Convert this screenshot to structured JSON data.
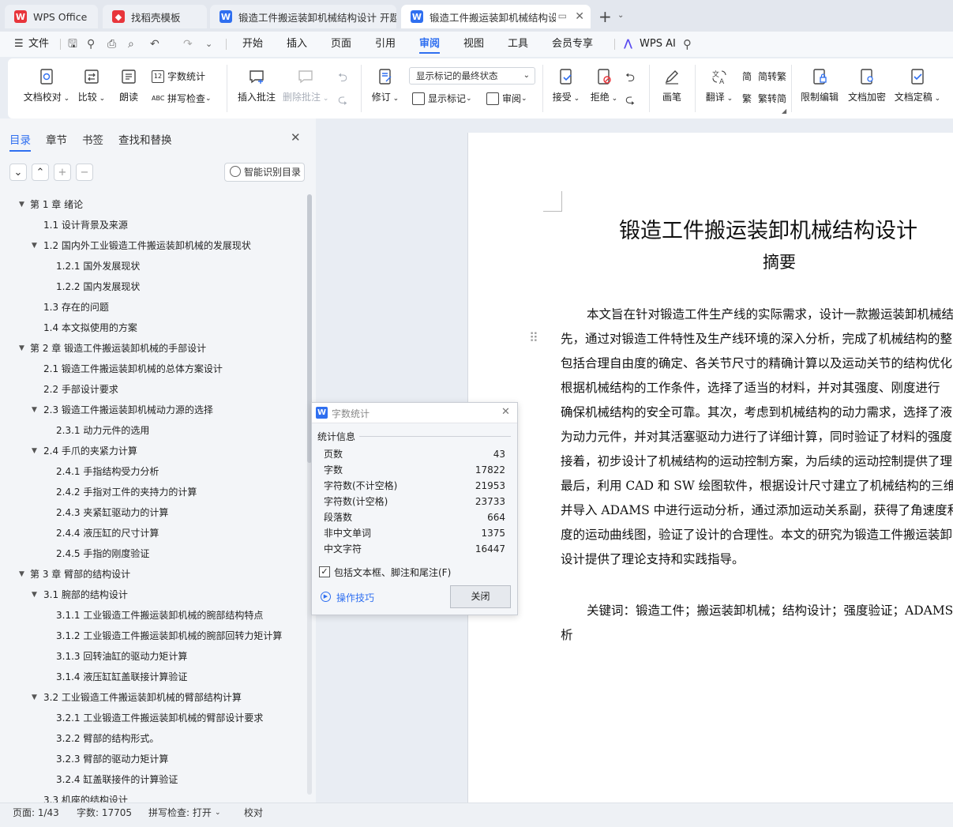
{
  "tabs": [
    {
      "label": "WPS Office",
      "logo": "W",
      "color": "#e8353b"
    },
    {
      "label": "找稻壳模板",
      "logo": "稻",
      "color": "#e8353b"
    },
    {
      "label": "锻造工件搬运装卸机械结构设计 开题",
      "logo": "W",
      "color": "#2f6ff0"
    },
    {
      "label": "锻造工件搬运装卸机械结构设",
      "logo": "W",
      "color": "#2f6ff0"
    }
  ],
  "menu": {
    "file": "文件",
    "items": [
      "开始",
      "插入",
      "页面",
      "引用",
      "审阅",
      "视图",
      "工具",
      "会员专享"
    ],
    "active": "审阅",
    "ai": "WPS AI"
  },
  "ribbon": {
    "doc_check": "文档校对",
    "compare": "比较",
    "read_aloud": "朗读",
    "word_count": "字数统计",
    "spell_check": "拼写检查",
    "insert_comment": "插入批注",
    "delete_comment": "删除批注",
    "track": "修订",
    "markup_state": "显示标记的最终状态",
    "show_markup": "显示标记",
    "review": "审阅",
    "accept": "接受",
    "reject": "拒绝",
    "pen": "画笔",
    "translate": "翻译",
    "to_traditional": "简转繁",
    "to_simplified": "繁转简",
    "restrict": "限制编辑",
    "encrypt": "文档加密",
    "finalize": "文档定稿"
  },
  "panel": {
    "tabs": [
      "目录",
      "章节",
      "书签",
      "查找和替换"
    ],
    "smart_toc": "智能识别目录",
    "toc": [
      {
        "text": "第 1 章  绪论",
        "level": 0,
        "expand": true
      },
      {
        "text": "1.1 设计背景及来源",
        "level": 1,
        "expand": false
      },
      {
        "text": "1.2 国内外工业锻造工件搬运装卸机械的发展现状",
        "level": 1,
        "expand": true
      },
      {
        "text": "1.2.1 国外发展现状",
        "level": 2,
        "expand": false
      },
      {
        "text": "1.2.2 国内发展现状",
        "level": 2,
        "expand": false
      },
      {
        "text": "1.3 存在的问题",
        "level": 1,
        "expand": false
      },
      {
        "text": "1.4 本文拟使用的方案",
        "level": 1,
        "expand": false
      },
      {
        "text": "第 2 章  锻造工件搬运装卸机械的手部设计",
        "level": 0,
        "expand": true
      },
      {
        "text": "2.1  锻造工件搬运装卸机械的总体方案设计",
        "level": 1,
        "expand": false
      },
      {
        "text": "2.2  手部设计要求",
        "level": 1,
        "expand": false
      },
      {
        "text": "2.3  锻造工件搬运装卸机械动力源的选择",
        "level": 1,
        "expand": true
      },
      {
        "text": "2.3.1 动力元件的选用",
        "level": 2,
        "expand": false
      },
      {
        "text": "2.4  手爪的夹紧力计算",
        "level": 1,
        "expand": true
      },
      {
        "text": "2.4.1  手指结构受力分析",
        "level": 2,
        "expand": false
      },
      {
        "text": "2.4.2 手指对工件的夹持力的计算",
        "level": 2,
        "expand": false
      },
      {
        "text": "2.4.3 夹紧缸驱动力的计算",
        "level": 2,
        "expand": false
      },
      {
        "text": "2.4.4 液压缸的尺寸计算",
        "level": 2,
        "expand": false
      },
      {
        "text": "2.4.5 手指的刚度验证",
        "level": 2,
        "expand": false
      },
      {
        "text": "第 3 章    臂部的结构设计",
        "level": 0,
        "expand": true
      },
      {
        "text": "3.1  腕部的结构设计",
        "level": 1,
        "expand": true
      },
      {
        "text": "3.1.1 工业锻造工件搬运装卸机械的腕部结构特点",
        "level": 2,
        "expand": false
      },
      {
        "text": "3.1.2 工业锻造工件搬运装卸机械的腕部回转力矩计算",
        "level": 2,
        "expand": false
      },
      {
        "text": "3.1.3  回转油缸的驱动力矩计算",
        "level": 2,
        "expand": false
      },
      {
        "text": "3.1.4  液压缸缸盖联接计算验证",
        "level": 2,
        "expand": false
      },
      {
        "text": "3.2  工业锻造工件搬运装卸机械的臂部结构计算",
        "level": 1,
        "expand": true
      },
      {
        "text": "3.2.1 工业锻造工件搬运装卸机械的臂部设计要求",
        "level": 2,
        "expand": false
      },
      {
        "text": "3.2.2 臂部的结构形式。",
        "level": 2,
        "expand": false
      },
      {
        "text": "3.2.3 臂部的驱动力矩计算",
        "level": 2,
        "expand": false
      },
      {
        "text": "3.2.4 缸盖联接件的计算验证",
        "level": 2,
        "expand": false
      },
      {
        "text": "3.3 机座的结构设计",
        "level": 1,
        "expand": false
      }
    ]
  },
  "document": {
    "title": "锻造工件搬运装卸机械结构设计",
    "subtitle": "摘要",
    "lines": [
      "本文旨在针对锻造工件生产线的实际需求，设计一款搬运装卸机械结",
      "先，通过对锻造工件特性及生产线环境的深入分析，完成了机械结构的整",
      "包括合理自由度的确定、各关节尺寸的精确计算以及运动关节的结构优化",
      "根据机械结构的工作条件，选择了适当的材料，并对其强度、刚度进行",
      "确保机械结构的安全可靠。其次，考虑到机械结构的动力需求，选择了液",
      "为动力元件，并对其活塞驱动力进行了详细计算，同时验证了材料的强度",
      "接着，初步设计了机械结构的运动控制方案，为后续的运动控制提供了理",
      "最后，利用 CAD 和 SW 绘图软件，根据设计尺寸建立了机械结构的三维",
      "并导入 ADAMS 中进行运动分析，通过添加运动关系副，获得了角速度和",
      "度的运动曲线图，验证了设计的合理性。本文的研究为锻造工件搬运装卸",
      "设计提供了理论支持和实践指导。"
    ],
    "keywords_line1": "关键词：锻造工件；搬运装卸机械；结构设计；强度验证；ADAMS",
    "keywords_line2": "析"
  },
  "dialog": {
    "title": "字数统计",
    "section": "统计信息",
    "rows": [
      {
        "label": "页数",
        "value": "43"
      },
      {
        "label": "字数",
        "value": "17822"
      },
      {
        "label": "字符数(不计空格)",
        "value": "21953"
      },
      {
        "label": "字符数(计空格)",
        "value": "23733"
      },
      {
        "label": "段落数",
        "value": "664"
      },
      {
        "label": "非中文单词",
        "value": "1375"
      },
      {
        "label": "中文字符",
        "value": "16447"
      }
    ],
    "checkbox_label": "包括文本框、脚注和尾注(F)",
    "checkbox_checked": true,
    "tips": "操作技巧",
    "close": "关闭"
  },
  "status": {
    "page": "页面: 1/43",
    "words": "字数: 17705",
    "spell": "拼写检查: 打开",
    "proof": "校对"
  },
  "colors": {
    "accent": "#2f6ff0",
    "wps_red": "#e8353b"
  }
}
